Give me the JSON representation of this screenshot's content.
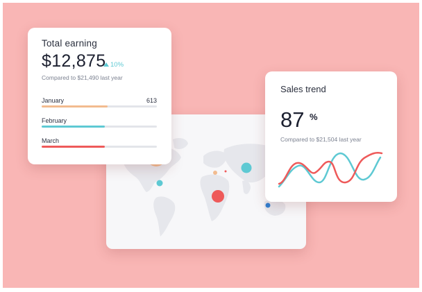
{
  "earning": {
    "title": "Total earning",
    "amount": "$12,875",
    "change": "10%",
    "compare": "Compared to $21,490 last year",
    "months": [
      {
        "label": "January",
        "value": "613",
        "progress": 0.57,
        "color": "#f2bb8f"
      },
      {
        "label": "February",
        "value": "",
        "progress": 0.55,
        "color": "#5ec9d3"
      },
      {
        "label": "March",
        "value": "",
        "progress": 0.55,
        "color": "#ee5a5a"
      }
    ]
  },
  "sales": {
    "title": "Sales trend",
    "value": "87",
    "unit": "%",
    "compare": "Compared to $21,504 last year",
    "colors": {
      "red": "#ee5a5a",
      "teal": "#5ec9d3"
    }
  },
  "map": {
    "land_color": "#e6e7ec",
    "bubble_colors": {
      "peach": "#f2bb8f",
      "teal": "#5ec9d3",
      "red": "#ee5a5a",
      "blue": "#2f7fd1"
    }
  }
}
